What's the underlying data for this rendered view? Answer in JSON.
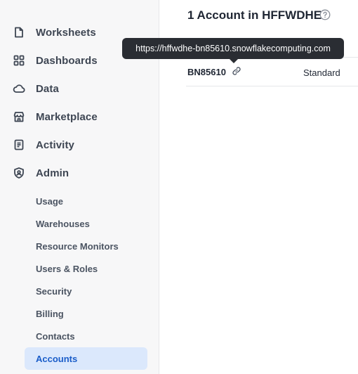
{
  "sidebar": {
    "items": [
      {
        "label": "Worksheets",
        "icon": "document-icon"
      },
      {
        "label": "Dashboards",
        "icon": "grid-icon"
      },
      {
        "label": "Data",
        "icon": "cloud-icon"
      },
      {
        "label": "Marketplace",
        "icon": "store-icon"
      },
      {
        "label": "Activity",
        "icon": "list-icon"
      },
      {
        "label": "Admin",
        "icon": "shield-icon"
      }
    ],
    "admin_subitems": [
      {
        "label": "Usage"
      },
      {
        "label": "Warehouses"
      },
      {
        "label": "Resource Monitors"
      },
      {
        "label": "Users & Roles"
      },
      {
        "label": "Security"
      },
      {
        "label": "Billing"
      },
      {
        "label": "Contacts"
      },
      {
        "label": "Accounts",
        "active": true
      }
    ]
  },
  "main": {
    "title": "1 Account in HFFWDHE",
    "tooltip": "https://hffwdhe-bn85610.snowflakecomputing.com",
    "rows": [
      {
        "account": "BN85610",
        "edition": "Standard"
      }
    ]
  },
  "colors": {
    "active_bg": "#dbe8fc",
    "active_text": "#1a5dc9",
    "tooltip_bg": "#2a2d33"
  }
}
